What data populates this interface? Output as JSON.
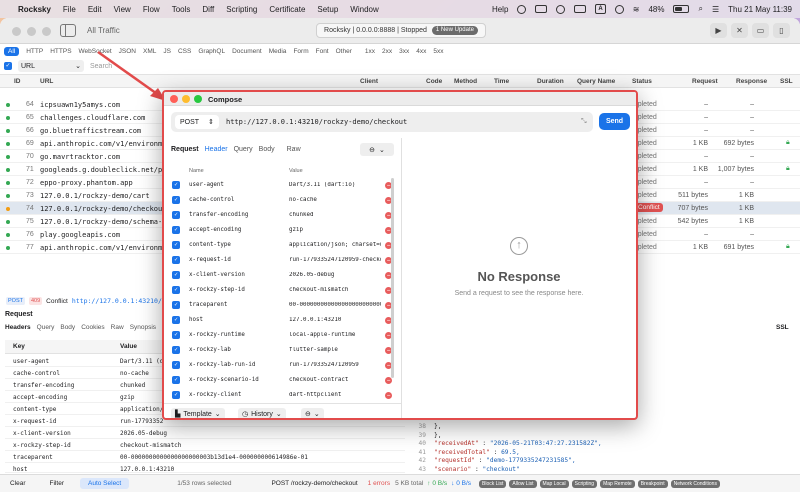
{
  "menubar": {
    "items": [
      "Rocksky",
      "File",
      "Edit",
      "View",
      "Flow",
      "Tools",
      "Diff",
      "Scripting",
      "Certificate",
      "Setup",
      "Window"
    ],
    "help": "Help",
    "battery": "48%",
    "datetime": "Thu 21 May  11:39"
  },
  "window": {
    "title": "All Traffic",
    "status": "Rocksky | 0.0.0.0:8888 | Stopped",
    "update_badge": "1 New Update"
  },
  "filters": [
    "All",
    "HTTP",
    "HTTPS",
    "WebSocket",
    "JSON",
    "XML",
    "JS",
    "CSS",
    "GraphQL",
    "Document",
    "Media",
    "Form",
    "Font",
    "Other",
    "1xx",
    "2xx",
    "3xx",
    "4xx",
    "5xx"
  ],
  "search": {
    "field": "URL",
    "placeholder": "Search"
  },
  "columns": {
    "id": "ID",
    "url": "URL",
    "client": "Client",
    "code": "Code",
    "method": "Method",
    "time": "Time",
    "duration": "Duration",
    "query": "Query Name",
    "status": "Status",
    "request": "Request",
    "response": "Response",
    "ssl": "SSL"
  },
  "rows": [
    {
      "id": "64",
      "url": "icpsuawn1y5amys.com",
      "status": "ompleted",
      "req": "–",
      "resp": "–"
    },
    {
      "id": "65",
      "url": "challenges.cloudflare.com",
      "status": "ompleted",
      "req": "–",
      "resp": "–"
    },
    {
      "id": "66",
      "url": "go.bluetrafficstream.com",
      "status": "ompleted",
      "req": "–",
      "resp": "–"
    },
    {
      "id": "69",
      "url": "api.anthropic.com/v1/environmen",
      "status": "ompleted",
      "req": "1 KB",
      "resp": "692 bytes"
    },
    {
      "id": "70",
      "url": "go.mavrtracktor.com",
      "status": "ompleted",
      "req": "–",
      "resp": "–"
    },
    {
      "id": "71",
      "url": "googleads.g.doubleclick.net/pag",
      "status": "ompleted",
      "req": "1 KB",
      "resp": "1,007 bytes"
    },
    {
      "id": "72",
      "url": "eppo-proxy.phantom.app",
      "status": "ompleted",
      "req": "–",
      "resp": "–"
    },
    {
      "id": "73",
      "url": "127.0.0.1/rockzy-demo/cart",
      "status": "ompleted",
      "req": "511 bytes",
      "resp": "1 KB"
    },
    {
      "id": "74",
      "url": "127.0.0.1/rockzy-demo/checkout",
      "status": "09 Conflict",
      "req": "707 bytes",
      "resp": "1 KB"
    },
    {
      "id": "75",
      "url": "127.0.0.1/rockzy-demo/schema-mi",
      "status": "ompleted",
      "req": "542 bytes",
      "resp": "1 KB"
    },
    {
      "id": "76",
      "url": "play.googleapis.com",
      "status": "ompleted",
      "req": "–",
      "resp": "–"
    },
    {
      "id": "77",
      "url": "api.anthropic.com/v1/environmen",
      "status": "ompleted",
      "req": "1 KB",
      "resp": "691 bytes"
    }
  ],
  "selected_summary": {
    "method": "POST",
    "code": "409",
    "text": "Conflict",
    "url": "http://127.0.0.1:43210/"
  },
  "request_panel": {
    "title": "Request",
    "tabs": [
      "Headers",
      "Query",
      "Body",
      "Cookies",
      "Raw",
      "Synopsis",
      "C"
    ],
    "ssl": "SSL",
    "key_col": "Key",
    "value_col": "Value",
    "rows": [
      {
        "k": "user-agent",
        "v": "Dart/3.11 (da"
      },
      {
        "k": "cache-control",
        "v": "no-cache"
      },
      {
        "k": "transfer-encoding",
        "v": "chunked"
      },
      {
        "k": "accept-encoding",
        "v": "gzip"
      },
      {
        "k": "content-type",
        "v": "application/"
      },
      {
        "k": "x-request-id",
        "v": "run-17793352"
      },
      {
        "k": "x-client-version",
        "v": "2026.05-debug"
      },
      {
        "k": "x-rockzy-step-id",
        "v": "checkout-mismatch"
      },
      {
        "k": "traceparent",
        "v": "00-0000000000000000000003b13d1e4-000000000614986e-01"
      },
      {
        "k": "host",
        "v": "127.0.0.1:43210"
      }
    ]
  },
  "code_lines": [
    {
      "n": "38",
      "t": "},"
    },
    {
      "n": "39",
      "t": "},"
    },
    {
      "n": "40",
      "key": "\"receivedAt\"",
      "val": "\"2026-05-21T03:47:27.231582Z\","
    },
    {
      "n": "41",
      "key": "\"receivedTotal\"",
      "val": "69.5,"
    },
    {
      "n": "42",
      "key": "\"requestId\"",
      "val": "\"demo-1779335247231585\","
    },
    {
      "n": "43",
      "key": "\"scenario\"",
      "val": "\"checkout\""
    },
    {
      "n": "44",
      "t": "}"
    }
  ],
  "bottombar": {
    "clear": "Clear",
    "filter": "Filter",
    "autoselect": "Auto Select",
    "rows_selected": "1/53 rows selected",
    "current": "POST /rockzy-demo/checkout",
    "errors": "1 errors",
    "size": "5 KB total",
    "up": "↑ 0 B/s",
    "down": "↓ 0 B/s",
    "chips": [
      "Block List",
      "Allow List",
      "Map Local",
      "Scripting",
      "Map Remote",
      "Breakpoint",
      "Network Conditions"
    ]
  },
  "compose": {
    "title": "Compose",
    "method": "POST",
    "url": "http://127.0.0.1:43210/rockzy-demo/checkout",
    "send": "Send",
    "tabs": [
      "Request",
      "Header",
      "Query",
      "Body",
      "Raw"
    ],
    "col_name": "Name",
    "col_value": "Value",
    "headers": [
      {
        "name": "user-agent",
        "value": "Dart/3.11 (dart:io)"
      },
      {
        "name": "cache-control",
        "value": "no-cache"
      },
      {
        "name": "transfer-encoding",
        "value": "chunked"
      },
      {
        "name": "accept-encoding",
        "value": "gzip"
      },
      {
        "name": "content-type",
        "value": "application/json; charset=ut"
      },
      {
        "name": "x-request-id",
        "value": "run-1779335247120959-checkou"
      },
      {
        "name": "x-client-version",
        "value": "2026.05-debug"
      },
      {
        "name": "x-rockzy-step-id",
        "value": "checkout-mismatch"
      },
      {
        "name": "traceparent",
        "value": "00-000000000000000000000000000"
      },
      {
        "name": "host",
        "value": "127.0.0.1:43210"
      },
      {
        "name": "x-rockzy-runtime",
        "value": "local-apple-runtime"
      },
      {
        "name": "x-rockzy-lab",
        "value": "flutter-sample"
      },
      {
        "name": "x-rockzy-lab-run-id",
        "value": "run-1779335247120959"
      },
      {
        "name": "x-rockzy-scenario-id",
        "value": "checkout-contract"
      },
      {
        "name": "x-rockzy-client",
        "value": "dart-httpclient"
      }
    ],
    "template_label": "Template",
    "history_label": "History",
    "no_response_title": "No Response",
    "no_response_sub": "Send a request to see the response here."
  }
}
